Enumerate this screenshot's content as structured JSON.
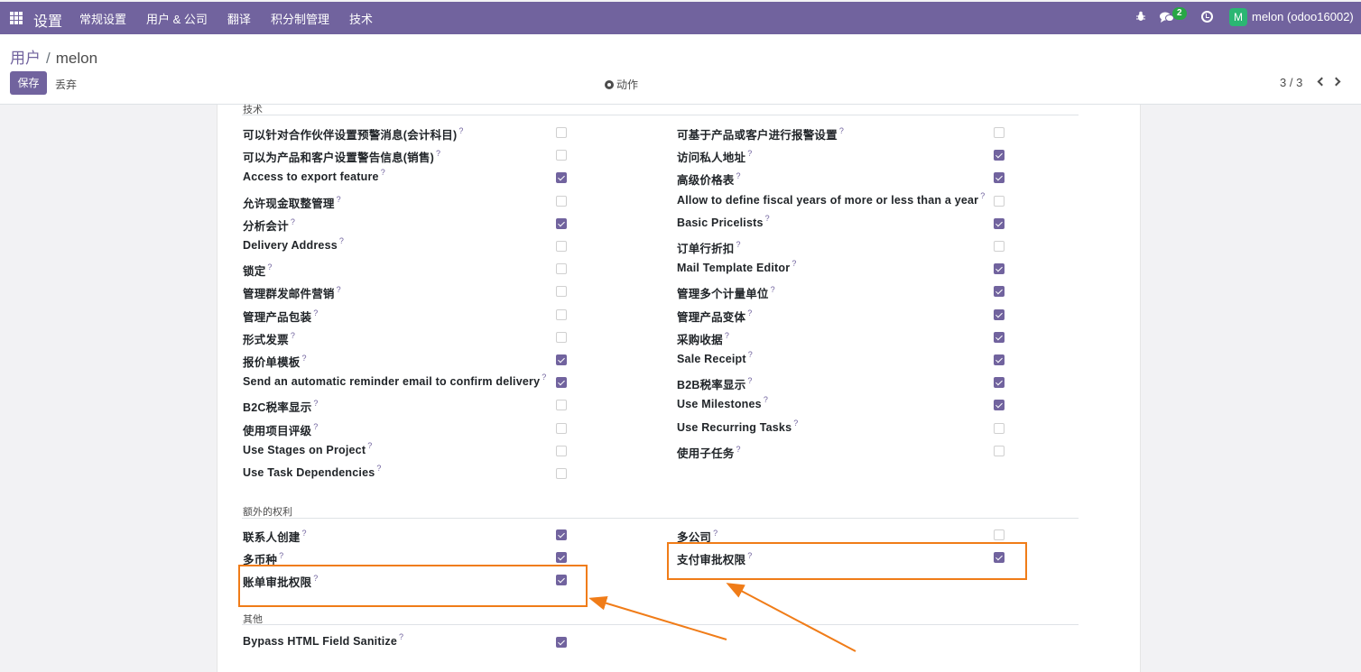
{
  "navbar": {
    "app_title": "设置",
    "menu": [
      "常规设置",
      "用户 & 公司",
      "翻译",
      "积分制管理",
      "技术"
    ],
    "chat_count": "2",
    "avatar_letter": "M",
    "username": "melon (odoo16002)"
  },
  "breadcrumb": {
    "parent": "用户",
    "separator": "/",
    "current": "melon"
  },
  "buttons": {
    "save": "保存",
    "discard": "丢弃",
    "action": "动作"
  },
  "pager": {
    "value": "3 / 3"
  },
  "sections": {
    "tech": "技术",
    "extra": "额外的权利",
    "other": "其他"
  },
  "tech_rows": [
    {
      "left": "可以针对合作伙伴设置预警消息(会计科目)",
      "left_on": false,
      "right": "可基于产品或客户进行报警设置",
      "right_on": false
    },
    {
      "left": "可以为产品和客户设置警告信息(销售)",
      "left_on": false,
      "right": "访问私人地址",
      "right_on": true
    },
    {
      "left": "Access to export feature",
      "left_on": true,
      "right": "高级价格表",
      "right_on": true
    },
    {
      "left": "允许现金取整管理",
      "left_on": false,
      "right": "Allow to define fiscal years of more or less than a year",
      "right_on": false
    },
    {
      "left": "分析会计",
      "left_on": true,
      "right": "Basic Pricelists",
      "right_on": true
    },
    {
      "left": "Delivery Address",
      "left_on": false,
      "right": "订单行折扣",
      "right_on": false
    },
    {
      "left": "锁定",
      "left_on": false,
      "right": "Mail Template Editor",
      "right_on": true
    },
    {
      "left": "管理群发邮件营销",
      "left_on": false,
      "right": "管理多个计量单位",
      "right_on": true
    },
    {
      "left": "管理产品包装",
      "left_on": false,
      "right": "管理产品变体",
      "right_on": true
    },
    {
      "left": "形式发票",
      "left_on": false,
      "right": "采购收据",
      "right_on": true
    },
    {
      "left": "报价单模板",
      "left_on": true,
      "right": "Sale Receipt",
      "right_on": true
    },
    {
      "left": "Send an automatic reminder email to confirm delivery",
      "left_on": true,
      "right": "B2B税率显示",
      "right_on": true
    },
    {
      "left": "B2C税率显示",
      "left_on": false,
      "right": "Use Milestones",
      "right_on": true
    },
    {
      "left": "使用项目评级",
      "left_on": false,
      "right": "Use Recurring Tasks",
      "right_on": false
    },
    {
      "left": "Use Stages on Project",
      "left_on": false,
      "right": "使用子任务",
      "right_on": false
    },
    {
      "left": "Use Task Dependencies",
      "left_on": false,
      "right": "",
      "right_on": null
    }
  ],
  "extra_rows": [
    {
      "left": "联系人创建",
      "left_on": true,
      "right": "多公司",
      "right_on": false
    },
    {
      "left": "多币种",
      "left_on": true,
      "right": "支付审批权限",
      "right_on": true
    },
    {
      "left": "账单审批权限",
      "left_on": true,
      "right": "",
      "right_on": null
    }
  ],
  "other_rows": [
    {
      "left": "Bypass HTML Field Sanitize",
      "left_on": true
    }
  ],
  "help_mark": "?",
  "colors": {
    "brand": "#71639e",
    "highlight": "#f07c18",
    "badge": "#28a745"
  }
}
